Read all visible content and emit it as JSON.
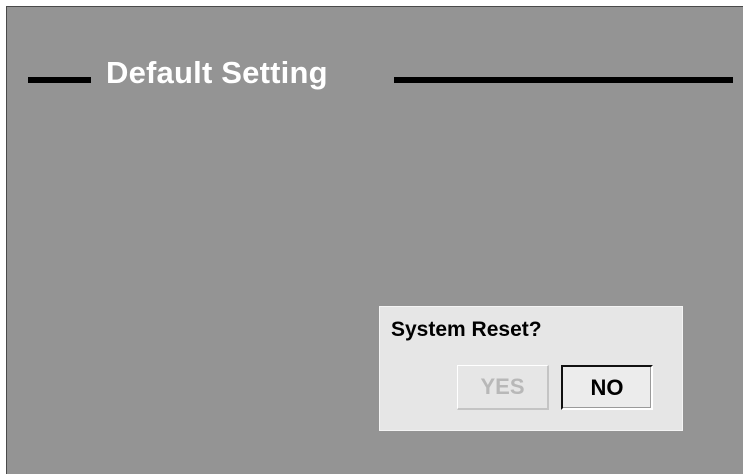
{
  "screen": {
    "title": "Default Setting"
  },
  "dialog": {
    "message": "System Reset?",
    "buttons": {
      "yes_label": "YES",
      "no_label": "NO"
    },
    "selected_button": "NO"
  },
  "colors": {
    "screen_background": "#949494",
    "dialog_background": "#e6e6e6",
    "title_text": "#ffffff",
    "disabled_text": "#b8b8b8"
  }
}
